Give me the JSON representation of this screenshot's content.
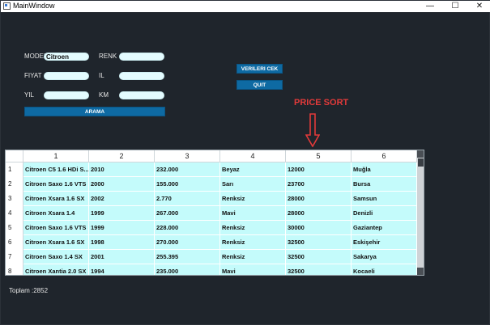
{
  "window": {
    "title": "MainWindow",
    "minimize": "—",
    "maximize": "☐",
    "close": "✕"
  },
  "form": {
    "model_label": "MODEL",
    "model_value": "Citroen",
    "renk_label": "RENK",
    "renk_value": "",
    "fiyat_label": "FIYAT",
    "fiyat_value": "",
    "il_label": "IL",
    "il_value": "",
    "yil_label": "YIL",
    "yil_value": "",
    "km_label": "KM",
    "km_value": "",
    "arama_button": "ARAMA"
  },
  "actions": {
    "verileri_cek": "VERILERI CEK",
    "quit": "QUIT"
  },
  "annotation": {
    "text": "PRICE SORT",
    "arrow": "⇩"
  },
  "table": {
    "headers": [
      "1",
      "2",
      "3",
      "4",
      "5",
      "6"
    ],
    "rows": [
      {
        "n": "1",
        "cells": [
          "Citroen C5 1.6 HDi S...",
          "2010",
          "232.000",
          "Beyaz",
          "12000",
          "Muğla"
        ]
      },
      {
        "n": "2",
        "cells": [
          "Citroen Saxo 1.6 VTS",
          "2000",
          "155.000",
          "Sarı",
          "23700",
          "Bursa"
        ]
      },
      {
        "n": "3",
        "cells": [
          "Citroen Xsara 1.6 SX",
          "2002",
          "2.770",
          "Renksiz",
          "28000",
          "Samsun"
        ]
      },
      {
        "n": "4",
        "cells": [
          "Citroen Xsara 1.4",
          "1999",
          "267.000",
          "Mavi",
          "28000",
          "Denizli"
        ]
      },
      {
        "n": "5",
        "cells": [
          "Citroen Saxo 1.6 VTS",
          "1999",
          "228.000",
          "Renksiz",
          "30000",
          "Gaziantep"
        ]
      },
      {
        "n": "6",
        "cells": [
          "Citroen Xsara 1.6 SX",
          "1998",
          "270.000",
          "Renksiz",
          "32500",
          "Eskişehir"
        ]
      },
      {
        "n": "7",
        "cells": [
          "Citroen Saxo 1.4 SX",
          "2001",
          "255.395",
          "Renksiz",
          "32500",
          "Sakarya"
        ]
      },
      {
        "n": "8",
        "cells": [
          "Citroen Xantia 2.0 SX",
          "1994",
          "235.000",
          "Mavi",
          "32500",
          "Kocaeli"
        ]
      }
    ]
  },
  "status": {
    "total": "Toplam :2852"
  },
  "colors": {
    "background": "#1f252c",
    "field": "#e4fcff",
    "button": "#0e6aa3",
    "cell": "#c4fbfb",
    "annotation": "#e23a3a"
  }
}
